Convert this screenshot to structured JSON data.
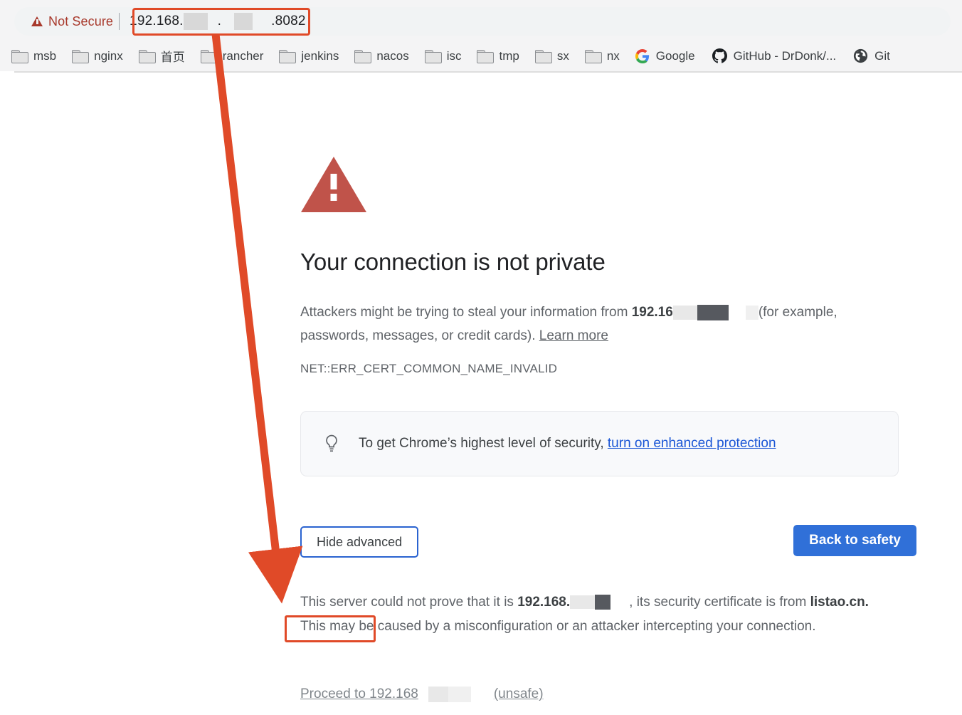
{
  "browser": {
    "security_badge": {
      "label": "Not Secure",
      "icon": "warning-triangle-icon",
      "color": "#a8392c"
    },
    "url": {
      "prefix": "192.168.",
      "middle_separator": ".",
      "suffix": ".8082",
      "redacted": true
    },
    "bookmarks": [
      {
        "label": "msb",
        "icon": "folder-icon"
      },
      {
        "label": "nginx",
        "icon": "folder-icon"
      },
      {
        "label": "首页",
        "icon": "folder-icon"
      },
      {
        "label": "rancher",
        "icon": "folder-icon"
      },
      {
        "label": "jenkins",
        "icon": "folder-icon"
      },
      {
        "label": "nacos",
        "icon": "folder-icon"
      },
      {
        "label": "isc",
        "icon": "folder-icon"
      },
      {
        "label": "tmp",
        "icon": "folder-icon"
      },
      {
        "label": "sx",
        "icon": "folder-icon"
      },
      {
        "label": "nx",
        "icon": "folder-icon"
      },
      {
        "label": "Google",
        "icon": "google-icon"
      },
      {
        "label": "GitHub - DrDonk/...",
        "icon": "github-icon"
      },
      {
        "label": "Git",
        "icon": "globe-icon"
      }
    ]
  },
  "interstitial": {
    "icon": "warning-triangle-icon",
    "title": "Your connection is not private",
    "body_lead": "Attackers might be trying to steal your information from ",
    "body_host": "192.16",
    "body_tail": "(for example, passwords, messages, or credit cards). ",
    "learn_more": "Learn more",
    "error_code": "NET::ERR_CERT_COMMON_NAME_INVALID",
    "enhanced": {
      "icon": "lightbulb-icon",
      "text": "To get Chrome’s highest level of security, ",
      "link": "turn on enhanced protection",
      "link_color": "#1a56d6"
    },
    "buttons": {
      "advanced": "Hide advanced",
      "back_to_safety": "Back to safety",
      "advanced_border_color": "#2a63d0",
      "safety_bg_color": "#3070d8"
    },
    "advanced": {
      "line1_lead": "This server could not prove that it is ",
      "line1_host": "192.168.",
      "line1_mid": ", its security certificate is from",
      "cert_host": "listao.cn.",
      "line2_tail": "This may be caused by a misconfiguration or an attacker intercepting your",
      "line3": "connection."
    },
    "proceed": {
      "lead": "Proceed to 192.168",
      "tail": "(unsafe)"
    }
  },
  "annotations": {
    "arrow_color": "#e04a28",
    "box_color": "#e04a28",
    "url_box_label": "url-highlight-box",
    "cert_box_label": "cert-host-highlight-box",
    "arrow_label": "pointer-arrow"
  }
}
